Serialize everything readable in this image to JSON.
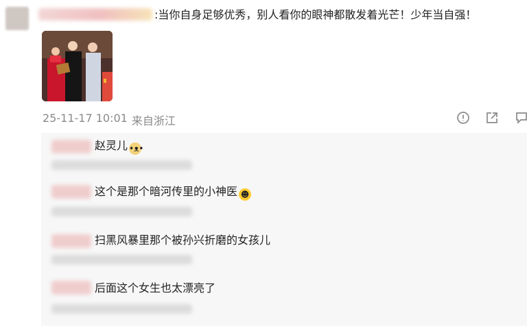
{
  "post": {
    "text": ":当你自身足够优秀，别人看你的眼神都散发着光芒！少年当自强！",
    "timestamp": "25-11-17 10:01",
    "source": "来自浙江"
  },
  "actions": [
    {
      "name": "report-icon"
    },
    {
      "name": "share-icon"
    },
    {
      "name": "comment-icon"
    }
  ],
  "comments": [
    {
      "text": "赵灵儿",
      "emoji": "dog-face-emoji"
    },
    {
      "text": "这个是那个暗河传里的小神医",
      "emoji": "grin-emoji"
    },
    {
      "text": "扫黑风暴里那个被孙兴折磨的女孩儿",
      "emoji": ""
    },
    {
      "text": "后面这个女生也太漂亮了",
      "emoji": ""
    }
  ],
  "colors": {
    "meta_text": "#8a8a8a",
    "comment_panel_bg": "#f7f7f7",
    "blurred_name": "#f0cdcd"
  }
}
